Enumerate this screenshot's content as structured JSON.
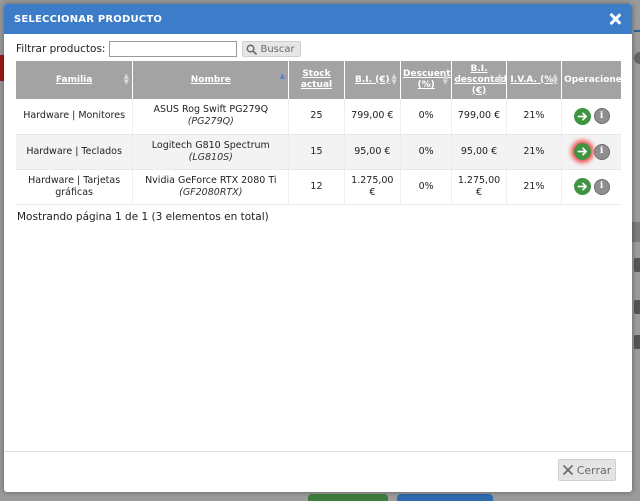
{
  "dialog": {
    "title": "SELECCIONAR PRODUCTO",
    "close_icon": "close-icon"
  },
  "filter": {
    "label": "Filtrar productos:",
    "value": "",
    "search_label": "Buscar",
    "search_icon": "search-icon"
  },
  "table": {
    "columns": [
      "Familia",
      "Nombre",
      "Stock actual",
      "B.I. (€)",
      "Descuento (%)",
      "B.I. descontada (€)",
      "I.V.A. (%)",
      "Operaciones"
    ],
    "sorted_column": "Nombre",
    "rows": [
      {
        "familia": "Hardware | Monitores",
        "nombre": "ASUS Rog Swift PG279Q",
        "codigo": "(PG279Q)",
        "stock": "25",
        "bi": "799,00 €",
        "descuento": "0%",
        "bi_desc": "799,00 €",
        "iva": "21%"
      },
      {
        "familia": "Hardware | Teclados",
        "nombre": "Logitech G810 Spectrum",
        "codigo": "(LG810S)",
        "stock": "15",
        "bi": "95,00 €",
        "descuento": "0%",
        "bi_desc": "95,00 €",
        "iva": "21%"
      },
      {
        "familia": "Hardware | Tarjetas gráficas",
        "nombre": "Nvidia GeForce RTX 2080 Ti",
        "codigo": "(GF2080RTX)",
        "stock": "12",
        "bi": "1.275,00 €",
        "descuento": "0%",
        "bi_desc": "1.275,00 €",
        "iva": "21%"
      }
    ],
    "row_actions": {
      "select_icon": "arrow-right-icon",
      "info_icon": "info-icon"
    }
  },
  "pager": {
    "text": "Mostrando página 1 de 1 (3 elementos en total)"
  },
  "footer": {
    "close_label": "Cerrar",
    "close_icon": "close-icon"
  },
  "colors": {
    "header_blue": "#3d7cc8",
    "table_header_gray": "#a3a3a3",
    "action_green": "#3f943f",
    "focus_red": "#f03c3c"
  }
}
